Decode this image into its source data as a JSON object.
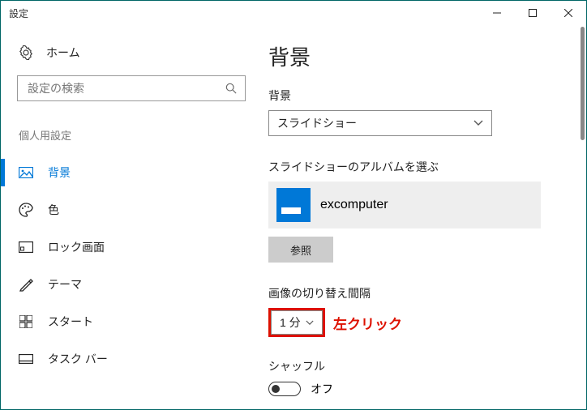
{
  "window": {
    "title": "設定"
  },
  "sidebar": {
    "home": "ホーム",
    "search_placeholder": "設定の検索",
    "group": "個人用設定",
    "items": [
      {
        "label": "背景"
      },
      {
        "label": "色"
      },
      {
        "label": "ロック画面"
      },
      {
        "label": "テーマ"
      },
      {
        "label": "スタート"
      },
      {
        "label": "タスク バー"
      }
    ]
  },
  "main": {
    "heading": "背景",
    "bg_label": "背景",
    "bg_value": "スライドショー",
    "album_label": "スライドショーのアルバムを選ぶ",
    "album_name": "excomputer",
    "browse": "参照",
    "interval_label": "画像の切り替え間隔",
    "interval_value": "1 分",
    "callout": "左クリック",
    "shuffle_label": "シャッフル",
    "shuffle_value": "オフ"
  }
}
